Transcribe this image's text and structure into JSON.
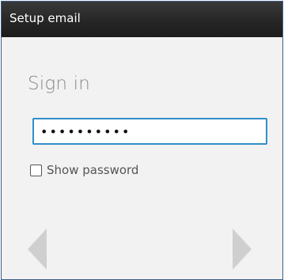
{
  "header": {
    "title": "Setup email"
  },
  "main": {
    "heading": "Sign in",
    "password": {
      "value": "••••••••••"
    },
    "show_password": {
      "label": "Show password",
      "checked": false
    }
  },
  "navigation": {
    "prev_icon": "left-triangle-icon",
    "next_icon": "right-triangle-icon",
    "arrow_color": "#cfcfcf"
  },
  "colors": {
    "titlebar": "#262626",
    "background": "#f2f2f2",
    "focus_border": "#2f8fc8",
    "frame_border": "#3b5f89"
  }
}
